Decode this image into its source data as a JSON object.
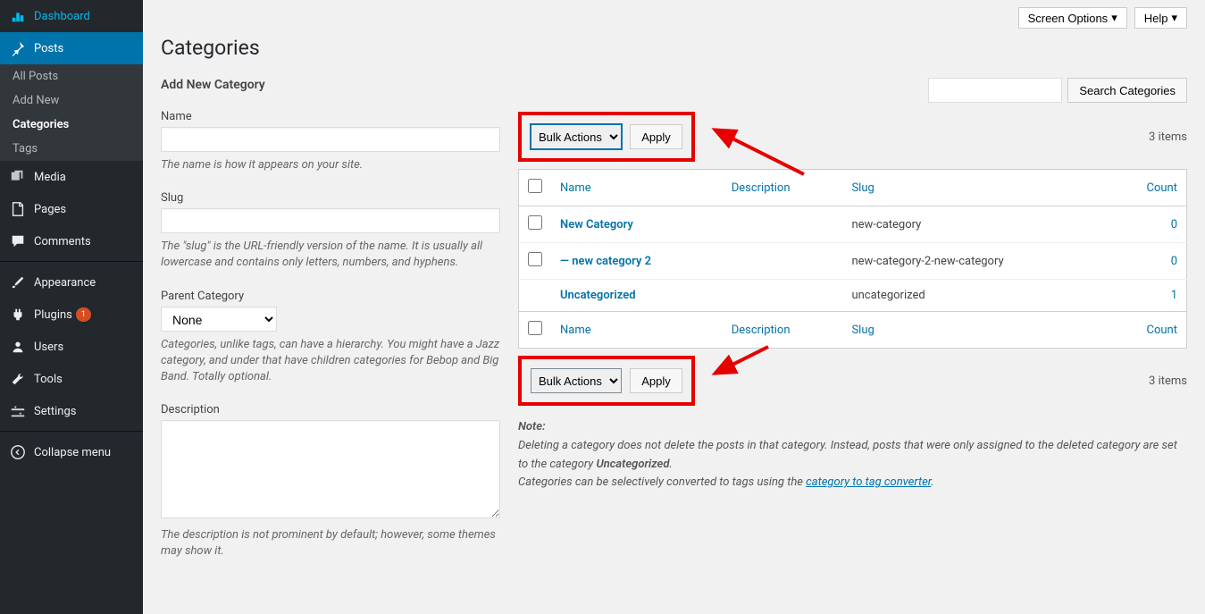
{
  "topbar": {
    "screen_options": "Screen Options",
    "help": "Help"
  },
  "sidebar": {
    "dashboard": "Dashboard",
    "posts": "Posts",
    "posts_sub": {
      "all_posts": "All Posts",
      "add_new": "Add New",
      "categories": "Categories",
      "tags": "Tags"
    },
    "media": "Media",
    "pages": "Pages",
    "comments": "Comments",
    "appearance": "Appearance",
    "plugins": "Plugins",
    "plugins_badge": "1",
    "users": "Users",
    "tools": "Tools",
    "settings": "Settings",
    "collapse": "Collapse menu"
  },
  "page": {
    "title": "Categories"
  },
  "form": {
    "title": "Add New Category",
    "name_label": "Name",
    "name_hint": "The name is how it appears on your site.",
    "slug_label": "Slug",
    "slug_hint": "The \"slug\" is the URL-friendly version of the name. It is usually all lowercase and contains only letters, numbers, and hyphens.",
    "parent_label": "Parent Category",
    "parent_value": "None",
    "parent_hint": "Categories, unlike tags, can have a hierarchy. You might have a Jazz category, and under that have children categories for Bebop and Big Band. Totally optional.",
    "desc_label": "Description",
    "desc_hint": "The description is not prominent by default; however, some themes may show it."
  },
  "list": {
    "search_button": "Search Categories",
    "bulk_actions": "Bulk Actions",
    "apply": "Apply",
    "items_count": "3 items",
    "cols": {
      "name": "Name",
      "description": "Description",
      "slug": "Slug",
      "count": "Count"
    },
    "rows": [
      {
        "name": "New Category",
        "slug": "new-category",
        "count": "0",
        "has_cb": true
      },
      {
        "name": "— new category 2",
        "slug": "new-category-2-new-category",
        "count": "0",
        "has_cb": true
      },
      {
        "name": "Uncategorized",
        "slug": "uncategorized",
        "count": "1",
        "has_cb": false
      }
    ]
  },
  "note": {
    "label": "Note:",
    "line1a": "Deleting a category does not delete the posts in that category. Instead, posts that were only assigned to the deleted category are set to the category ",
    "line1b": "Uncategorized",
    "line1c": ".",
    "line2a": "Categories can be selectively converted to tags using the ",
    "line2link": "category to tag converter",
    "line2b": "."
  }
}
